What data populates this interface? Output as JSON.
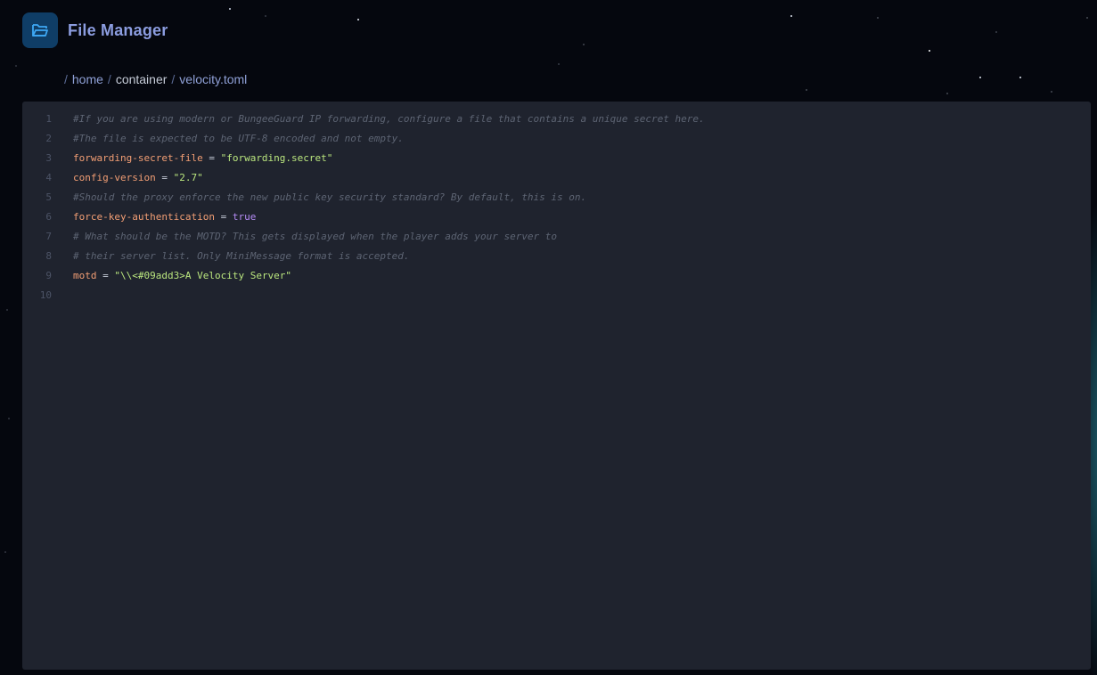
{
  "header": {
    "title": "File Manager",
    "icon": "folder-open-icon",
    "icon_color": "#3ea8f5"
  },
  "breadcrumb": {
    "separator": "/",
    "items": [
      "home",
      "container",
      "velocity.toml"
    ]
  },
  "editor": {
    "lines": [
      {
        "number": "1",
        "comment": "#If you are using modern or BungeeGuard IP forwarding, configure a file that contains a unique secret here."
      },
      {
        "number": "2",
        "comment": "#The file is expected to be UTF-8 encoded and not empty."
      },
      {
        "number": "3",
        "key": "forwarding-secret-file",
        "op": "=",
        "value": "\"forwarding.secret\""
      },
      {
        "number": "4",
        "key": "config-version",
        "op": "=",
        "value": "\"2.7\""
      },
      {
        "number": "5",
        "comment": "#Should the proxy enforce the new public key security standard? By default, this is on."
      },
      {
        "number": "6",
        "key": "force-key-authentication",
        "op": "=",
        "bool": "true"
      },
      {
        "number": "7",
        "comment": "# What should be the MOTD? This gets displayed when the player adds your server to"
      },
      {
        "number": "8",
        "comment": "# their server list. Only MiniMessage format is accepted."
      },
      {
        "number": "9",
        "key": "motd",
        "op": "=",
        "value": "\"\\\\<#09add3>A Velocity Server\""
      },
      {
        "number": "10"
      }
    ]
  },
  "colors": {
    "comment": "#5d6473",
    "key": "#f29e74",
    "string": "#bae67e",
    "boolean": "#b58cf6",
    "editor_bg": "#1f232e"
  }
}
